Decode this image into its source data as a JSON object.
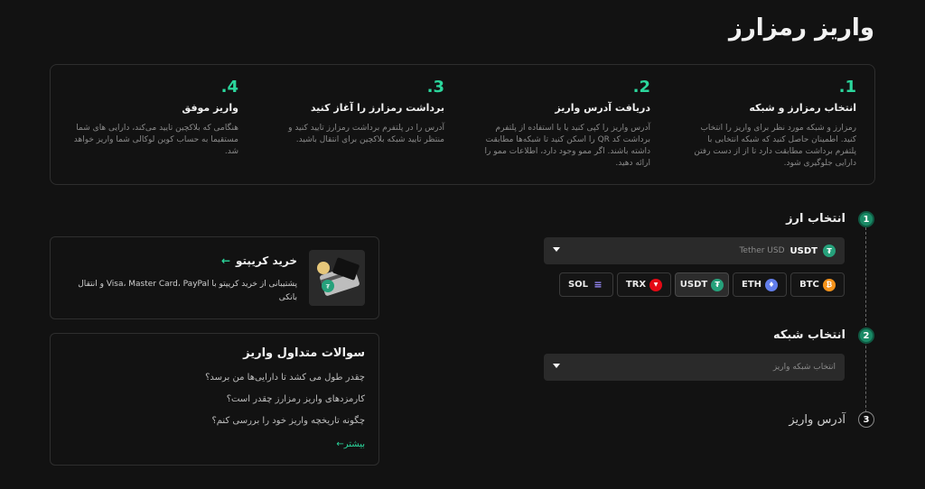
{
  "page": {
    "title": "واریز رمزارز"
  },
  "steps": [
    {
      "num": "1.",
      "title": "انتخاب رمزارز و شبکه",
      "desc": "رمزارز و شبکه مورد نظر برای واریز را انتخاب کنید. اطمینان حاصل کنید که شبکه انتخابی با پلتفرم برداشت مطابقت دارد تا از از دست رفتن دارایی جلوگیری شود."
    },
    {
      "num": "2.",
      "title": "دریافت آدرس واریز",
      "desc": "آدرس واریز را کپی کنید یا با استفاده از پلتفرم برداشت کد QR را اسکن کنید تا شبکه‌ها مطابقت داشته باشند. اگر ممو وجود دارد، اطلاعات ممو را ارائه دهید."
    },
    {
      "num": "3.",
      "title": "برداشت رمزارز را آغاز کنید",
      "desc": "آدرس را در پلتفرم برداشت رمزارز تایید کنید و منتظر تایید شبکه بلاکچین برای انتقال باشید."
    },
    {
      "num": "4.",
      "title": "واریز موفق",
      "desc": "هنگامی که بلاکچین تایید می‌کند، دارایی های شما مستقیما به حساب کوین لوکالی شما واریز خواهد شد."
    }
  ],
  "form": {
    "step1": {
      "num": "1",
      "label": "انتخاب ارز"
    },
    "currency_select": {
      "code": "USDT",
      "name": "Tether USD",
      "icon_letter": "₮",
      "icon_color": "#26a17b"
    },
    "coins": [
      {
        "code": "BTC",
        "icon": "bitcoin-icon",
        "glyph": "₿",
        "color": "#f7931a"
      },
      {
        "code": "ETH",
        "icon": "ethereum-icon",
        "glyph": "♦",
        "color": "#627eea"
      },
      {
        "code": "USDT",
        "icon": "tether-icon",
        "glyph": "₮",
        "color": "#26a17b"
      },
      {
        "code": "TRX",
        "icon": "tron-icon",
        "glyph": "▼",
        "color": "#e50915"
      },
      {
        "code": "SOL",
        "icon": "solana-icon",
        "glyph": "≡",
        "color": "#9945ff"
      }
    ],
    "selected_coin": "USDT",
    "step2": {
      "num": "2",
      "label": "انتخاب شبکه"
    },
    "network_select": {
      "placeholder": "انتخاب شبکه واریز"
    },
    "step3": {
      "num": "3",
      "label": "آدرس واریز"
    }
  },
  "buy_card": {
    "title": "خرید کریپتو",
    "arrow": "←",
    "desc": "پشتیبانی از خرید کریپتو با Visa، Master Card، PayPal و انتقال بانکی"
  },
  "faq": {
    "title": "سوالات متداول واریز",
    "items": [
      "چقدر طول می کشد تا دارایی‌ها من برسد؟",
      "کارمزدهای واریز رمزارز چقدر است؟",
      "چگونه تاریخچه واریز خود را بررسی کنم؟"
    ],
    "more": "بیشتر",
    "more_arrow": "←"
  },
  "colors": {
    "accent": "#2bd69c",
    "background": "#121212"
  }
}
